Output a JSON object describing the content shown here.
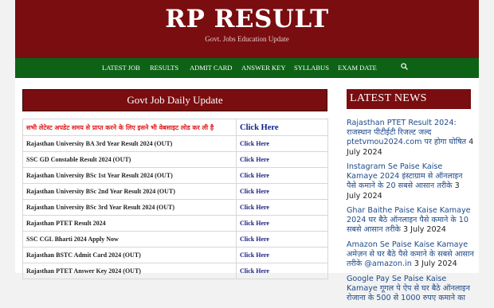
{
  "header": {
    "title": "RP RESULT",
    "tagline": "Govt. Jobs Education Update"
  },
  "nav": {
    "items": [
      "LATEST JOB",
      "RESULTS",
      "ADMIT CARD",
      "ANSWER KEY",
      "SYLLABUS",
      "EXAM DATE"
    ],
    "search_icon": "search-icon"
  },
  "main": {
    "panel_title": "Govt Job Daily Update",
    "rows": [
      {
        "title": "सभी लेटेस्ट अपडेट समय से प्राप्त करने के लिए इसने भी वेबसाइट लोड कर ली है",
        "link": "Click Here"
      },
      {
        "title": "Rajasthan University BA 3rd Year Result 2024 (OUT)",
        "link": "Click Here"
      },
      {
        "title": "SSC GD Constable Result 2024 (OUT)",
        "link": "Click Here"
      },
      {
        "title": "Rajasthan University BSc 1st Year Result 2024 (OUT)",
        "link": "Click Here"
      },
      {
        "title": "Rajasthan University BSc 2nd Year Result 2024 (OUT)",
        "link": "Click Here"
      },
      {
        "title": "Rajasthan University BSc 3rd Year Result 2024 (OUT)",
        "link": "Click Here"
      },
      {
        "title": "Rajasthan PTET Result 2024",
        "link": "Click Here"
      },
      {
        "title": "SSC CGL Bharti 2024 Apply Now",
        "link": "Click Here"
      },
      {
        "title": "Rajasthan BSTC Admit Card 2024 (OUT)",
        "link": "Click Here"
      },
      {
        "title": "Rajasthan PTET Answer Key 2024 (OUT)",
        "link": "Click Here"
      }
    ]
  },
  "sidebar": {
    "title": "LATEST NEWS",
    "news": [
      {
        "link": "Rajasthan PTET Result 2024: राजस्थान पीटीईटी रिजल्ट जल्द ptetvmou2024.com पर होगा घोषित",
        "date": "4 July 2024"
      },
      {
        "link": "Instagram Se Paise Kaise Kamaye 2024 इंस्टाग्राम से ऑनलाइन पैसे कमाने के 20 सबसे आसान तरीके",
        "date": "3 July 2024"
      },
      {
        "link": "Ghar Baithe Paise Kaise Kamaye 2024 घर बैठे ऑनलाइन पैसे कमाने के 10 सबसे आसान तरीके",
        "date": "3 July 2024"
      },
      {
        "link": "Amazon Se Paise Kaise Kamaye अमेज़न से घर बैठे पैसे कमाने के सबसे आसान तरीके @amazon.in",
        "date": "3 July 2024"
      },
      {
        "link": "Google Pay Se Paise Kaise Kamaye गूगल पे ऐप से घर बैठे ऑनलाइन रोजाना के 500 से 1000 रुपए कमाने का",
        "date": ""
      }
    ]
  }
}
